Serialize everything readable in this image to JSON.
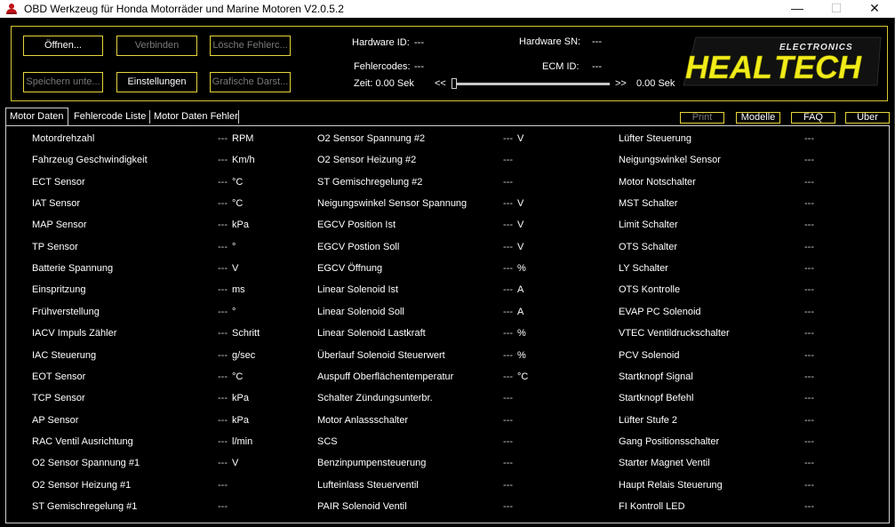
{
  "window": {
    "title": "OBD Werkzeug für Honda Motorräder und Marine Motoren V2.0.5.2",
    "minimize_glyph": "—",
    "maximize_glyph": "☐",
    "close_glyph": "✕"
  },
  "toolbar": {
    "open": "Öffnen...",
    "connect": "Verbinden",
    "clear_codes": "Lösche Fehlerc...",
    "save": "Speichern unte...",
    "settings": "Einstellungen",
    "graphics": "Grafische Darst..."
  },
  "info": {
    "hardware_id_label": "Hardware ID:",
    "hardware_id_value": "---",
    "hardware_sn_label": "Hardware SN:",
    "hardware_sn_value": "---",
    "fault_codes_label": "Fehlercodes:",
    "fault_codes_value": "---",
    "ecm_id_label": "ECM ID:",
    "ecm_id_value": "---",
    "time_left": "Zeit: 0.00 Sek",
    "rewind": "<<",
    "forward": ">>",
    "time_right": "0.00 Sek"
  },
  "logo": {
    "heal": "HEAL",
    "tech": "TECH",
    "electronics": "ELECTRONICS"
  },
  "tabs": [
    {
      "label": "Motor Daten",
      "active": true
    },
    {
      "label": "Fehlercode Liste",
      "active": false
    },
    {
      "label": "Motor Daten Fehler",
      "active": false
    }
  ],
  "right_buttons": {
    "print": "Print",
    "models": "Modelle",
    "faq": "FAQ",
    "about": "Über"
  },
  "columns": [
    {
      "rows": [
        {
          "name": "Motordrehzahl",
          "value": "---",
          "unit": "RPM"
        },
        {
          "name": "Fahrzeug Geschwindigkeit",
          "value": "---",
          "unit": "Km/h"
        },
        {
          "name": "ECT Sensor",
          "value": "---",
          "unit": "°C"
        },
        {
          "name": "IAT Sensor",
          "value": "---",
          "unit": "°C"
        },
        {
          "name": "MAP Sensor",
          "value": "---",
          "unit": "kPa"
        },
        {
          "name": "TP Sensor",
          "value": "---",
          "unit": "°"
        },
        {
          "name": "Batterie Spannung",
          "value": "---",
          "unit": "V"
        },
        {
          "name": "Einspritzung",
          "value": "---",
          "unit": "ms"
        },
        {
          "name": "Frühverstellung",
          "value": "---",
          "unit": "°"
        },
        {
          "name": "IACV Impuls Zähler",
          "value": "---",
          "unit": "Schritt"
        },
        {
          "name": "IAC Steuerung",
          "value": "---",
          "unit": "g/sec"
        },
        {
          "name": "EOT Sensor",
          "value": "---",
          "unit": "°C"
        },
        {
          "name": "TCP Sensor",
          "value": "---",
          "unit": "kPa"
        },
        {
          "name": "AP Sensor",
          "value": "---",
          "unit": "kPa"
        },
        {
          "name": "RAC Ventil Ausrichtung",
          "value": "---",
          "unit": "l/min"
        },
        {
          "name": "O2 Sensor Spannung #1",
          "value": "---",
          "unit": "V"
        },
        {
          "name": "O2 Sensor Heizung #1",
          "value": "---",
          "unit": ""
        },
        {
          "name": "ST Gemischregelung #1",
          "value": "---",
          "unit": ""
        }
      ]
    },
    {
      "rows": [
        {
          "name": "O2 Sensor Spannung #2",
          "value": "---",
          "unit": "V"
        },
        {
          "name": "O2 Sensor Heizung #2",
          "value": "---",
          "unit": ""
        },
        {
          "name": "ST Gemischregelung #2",
          "value": "---",
          "unit": ""
        },
        {
          "name": "Neigungswinkel Sensor Spannung",
          "value": "---",
          "unit": "V"
        },
        {
          "name": "EGCV Position Ist",
          "value": "---",
          "unit": "V"
        },
        {
          "name": "EGCV Postion Soll",
          "value": "---",
          "unit": "V"
        },
        {
          "name": "EGCV Öffnung",
          "value": "---",
          "unit": "%"
        },
        {
          "name": "Linear Solenoid Ist",
          "value": "---",
          "unit": "A"
        },
        {
          "name": "Linear Solenoid Soll",
          "value": "---",
          "unit": "A"
        },
        {
          "name": "Linear Solenoid Lastkraft",
          "value": "---",
          "unit": "%"
        },
        {
          "name": "Überlauf Solenoid Steuerwert",
          "value": "---",
          "unit": "%"
        },
        {
          "name": "Auspuff Oberflächentemperatur",
          "value": "---",
          "unit": "°C"
        },
        {
          "name": "Schalter Zündungsunterbr.",
          "value": "---",
          "unit": ""
        },
        {
          "name": "Motor Anlassschalter",
          "value": "---",
          "unit": ""
        },
        {
          "name": "SCS",
          "value": "---",
          "unit": ""
        },
        {
          "name": "Benzinpumpensteuerung",
          "value": "---",
          "unit": ""
        },
        {
          "name": "Lufteinlass Steuerventil",
          "value": "---",
          "unit": ""
        },
        {
          "name": "PAIR Solenoid Ventil",
          "value": "---",
          "unit": ""
        }
      ]
    },
    {
      "rows": [
        {
          "name": "Lüfter Steuerung",
          "value": "---",
          "unit": ""
        },
        {
          "name": "Neigungswinkel Sensor",
          "value": "---",
          "unit": ""
        },
        {
          "name": "Motor Notschalter",
          "value": "---",
          "unit": ""
        },
        {
          "name": "MST Schalter",
          "value": "---",
          "unit": ""
        },
        {
          "name": "Limit Schalter",
          "value": "---",
          "unit": ""
        },
        {
          "name": "OTS Schalter",
          "value": "---",
          "unit": ""
        },
        {
          "name": "LY Schalter",
          "value": "---",
          "unit": ""
        },
        {
          "name": "OTS Kontrolle",
          "value": "---",
          "unit": ""
        },
        {
          "name": "EVAP PC Solenoid",
          "value": "---",
          "unit": ""
        },
        {
          "name": "VTEC Ventildruckschalter",
          "value": "---",
          "unit": ""
        },
        {
          "name": "PCV Solenoid",
          "value": "---",
          "unit": ""
        },
        {
          "name": "Startknopf Signal",
          "value": "---",
          "unit": ""
        },
        {
          "name": "Startknopf Befehl",
          "value": "---",
          "unit": ""
        },
        {
          "name": "Lüfter Stufe 2",
          "value": "---",
          "unit": ""
        },
        {
          "name": "Gang Positionsschalter",
          "value": "---",
          "unit": ""
        },
        {
          "name": "Starter Magnet Ventil",
          "value": "---",
          "unit": ""
        },
        {
          "name": "Haupt Relais Steuerung",
          "value": "---",
          "unit": ""
        },
        {
          "name": "FI Kontroll LED",
          "value": "---",
          "unit": ""
        }
      ]
    }
  ]
}
